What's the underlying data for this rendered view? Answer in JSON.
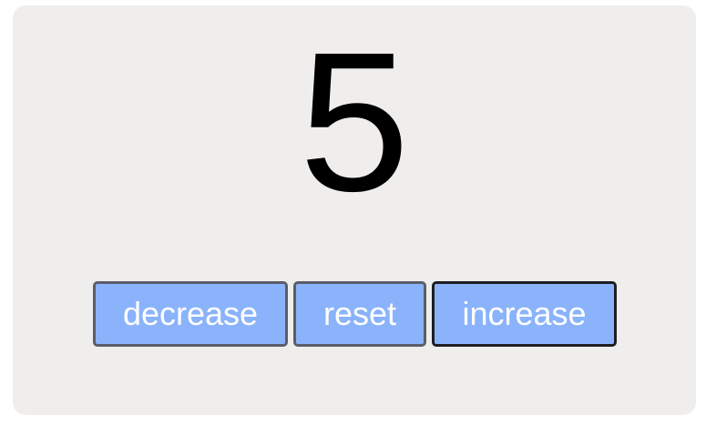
{
  "counter": {
    "value": "5"
  },
  "buttons": {
    "decrease_label": "decrease",
    "reset_label": "reset",
    "increase_label": "increase"
  },
  "colors": {
    "card_background": "#f0eeec",
    "button_fill": "#8ab3fb",
    "button_text": "#ffffff",
    "count_text": "#000000"
  }
}
